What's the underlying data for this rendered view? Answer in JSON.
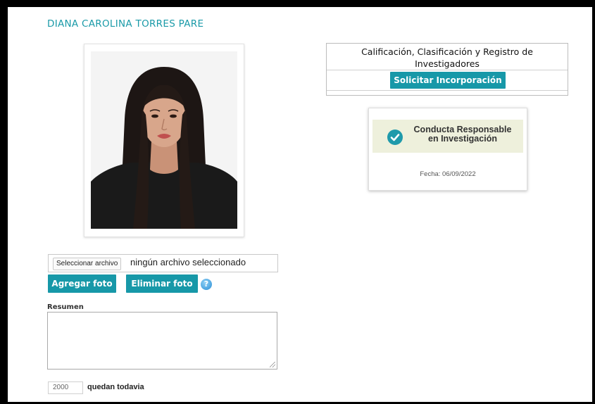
{
  "profile": {
    "name": "DIANA CAROLINA TORRES PARE"
  },
  "photo_upload": {
    "choose_button": "Seleccionar archivo",
    "status": "ningún archivo seleccionado",
    "add_label": "Agregar foto",
    "delete_label": "Eliminar foto",
    "help_icon": "question-circle-icon"
  },
  "summary": {
    "label": "Resumen",
    "value": "",
    "counter_value": "2000",
    "counter_label": "quedan todavia"
  },
  "registry": {
    "title_line1": "Calificación, Clasificación y Registro de",
    "title_line2": "Investigadores",
    "request_label": "Solicitar Incorporación"
  },
  "conduct": {
    "line1": "Conducta Responsable",
    "line2": "en Investigación",
    "date": "Fecha: 06/09/2022",
    "icon": "check-circle-icon"
  },
  "colors": {
    "accent": "#1798a8",
    "name_text": "#1a9aa8",
    "badge_bg": "#eef0dc"
  }
}
